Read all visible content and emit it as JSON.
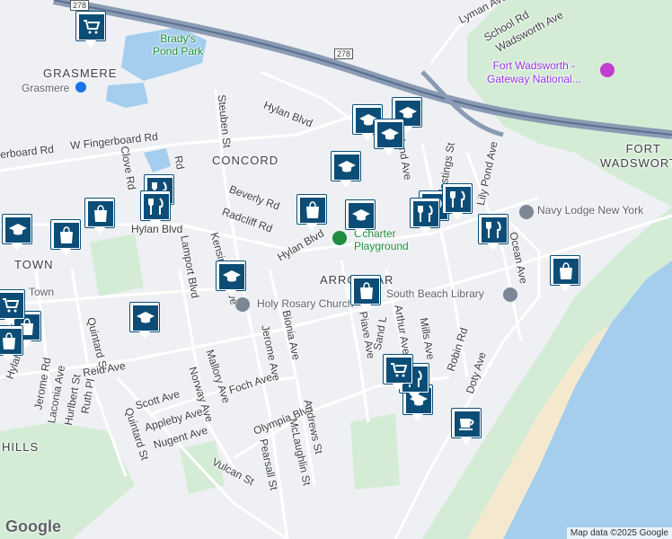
{
  "map": {
    "areas": {
      "grasmere_area": "GRASMERE",
      "concord": "CONCORD",
      "fort_wadsworth": "FORT\nWADSWORTH",
      "arrochar": "ARROCHAR",
      "town": "TOWN",
      "hills": "HILLS"
    },
    "places": {
      "bradys_pond_park": "Brady's\nPond Park",
      "fort_wadsworth_gateway": "Fort Wadsworth -\nGateway National...",
      "navy_lodge": "Navy Lodge New York",
      "south_beach_library": "South Beach Library",
      "holy_rosary": "Holy Rosary Church",
      "ocharter_playground": "Ocharter\nPlayground",
      "grasmere_station": "Grasmere",
      "town_small": "Town"
    },
    "streets": {
      "lyman": "Lyman Ave",
      "school_rd": "School Rd",
      "wadsworth": "Wadsworth Ave",
      "i278_a": "278",
      "i278_b": "278",
      "hylan_top": "Hylan Blvd",
      "w_fingerboard": "W Fingerboard Rd",
      "clove": "Clove Rd",
      "steuben": "Steuben St",
      "beverly": "Beverly Rd",
      "radcliff": "Radcliff Rd",
      "hylan_mid": "Hylan Blvd",
      "hylan_left": "Hylan Blvd",
      "hylan_bottom_left": "Hylan",
      "lamport": "Lamport Blvd",
      "kensington": "Kensington Ave",
      "lily_pond": "Lily Pond Ave",
      "ocean_ave": "Ocean Ave",
      "mills": "Mills Ave",
      "arthur": "Arthur Ave",
      "sand": "Sand L",
      "piave": "Piave Ave",
      "robin": "Robin Rd",
      "doty": "Doty Ave",
      "olympia": "Olympia Blvd",
      "andrews": "Andrews St",
      "mclaughlin": "McLaughlin St",
      "pearsall": "Pearsall St",
      "vulcan": "Vulcan St",
      "nugent": "Nugent Ave",
      "appleby": "Appleby Ave",
      "scott": "Scott Ave",
      "foch": "Foch Ave",
      "mallory": "Mallory Ave",
      "norway": "Norway Ave",
      "jerome_ave": "Jerome Ave",
      "bionia": "Bionia Ave",
      "quintard_st": "Quintard St",
      "quintard_st_top": "Quintard St",
      "reid": "Reid Ave",
      "jerome_rd": "Jerome Rd",
      "laconia": "Laconia Ave",
      "hurlbert": "Hurlbert St",
      "ruth": "Ruth Pl",
      "hastings": "Hastings St",
      "island": "Island Ave",
      "rd_small": "Rd",
      "fingerboard_left": "erboard Rd"
    },
    "icons": {
      "school": "graduation-cap-icon",
      "restaurant": "fork-knife-icon",
      "shopping": "shopping-bag-icon",
      "grocery": "shopping-cart-icon",
      "cafe": "coffee-cup-icon"
    },
    "colors": {
      "marker_fill": "#0c4d77",
      "highway": "#8b9bb4",
      "water": "#a5cdee",
      "park": "#d4ecd5"
    }
  },
  "attribution": {
    "logo": "Google",
    "copyright": "Map data ©2025 Google"
  }
}
